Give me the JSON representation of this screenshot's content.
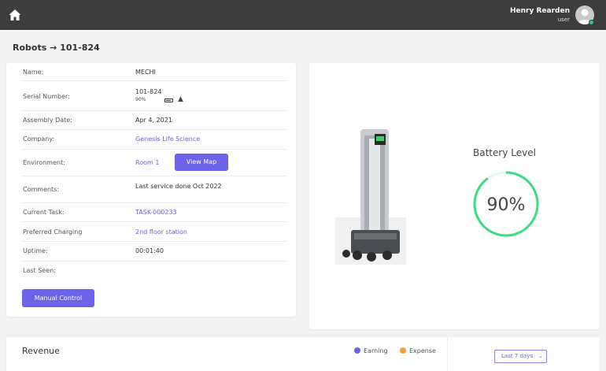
{
  "header": {
    "user_name": "Henry Rearden",
    "user_role": "user",
    "home_icon": "home-icon",
    "avatar_icon": "avatar-icon",
    "status_color": "#2ecc71"
  },
  "breadcrumb": {
    "parent": "Robots",
    "separator": "→",
    "current": "101-824"
  },
  "robot_info": {
    "rows": [
      {
        "label": "Name:",
        "value": "MECHI"
      },
      {
        "label": "Serial Number:",
        "value": "101-824",
        "battery_text": "90%"
      },
      {
        "label": "Assembly Date:",
        "value": "Apr 4, 2021"
      },
      {
        "label": "Company:",
        "value": "Genesis Life Science"
      },
      {
        "label": "Environment:",
        "value": "Room 1"
      },
      {
        "label": "Comments:",
        "value": "Last service done Oct 2022"
      },
      {
        "label": "Current Task:",
        "value": "TASK-000233"
      },
      {
        "label": "Preferred Charging",
        "value": "2nd floor station"
      },
      {
        "label": "Uptime:",
        "value": "00:01:40"
      },
      {
        "label": "Last Seen:",
        "value": ""
      }
    ],
    "view_map_label": "View Map",
    "manual_control_label": "Manual Control"
  },
  "battery": {
    "title": "Battery Level",
    "value_text": "90%",
    "level": 0.9,
    "ring_color": "#3ddc84"
  },
  "revenue": {
    "title": "Revenue",
    "legend": [
      {
        "name": "Earning",
        "color": "#6c63e8"
      },
      {
        "name": "Expense",
        "color": "#f5a03a"
      }
    ],
    "range_label": "Last 7 days"
  },
  "accent_color": "#6c63e8"
}
